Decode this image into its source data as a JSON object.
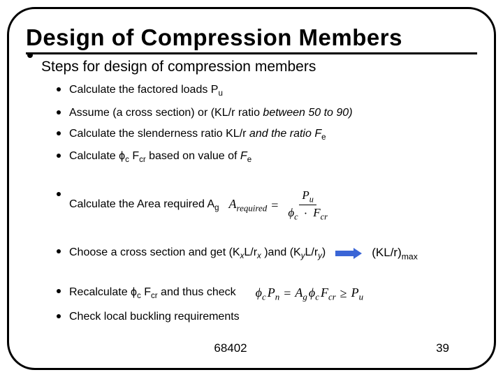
{
  "title": "Design of Compression Members",
  "heading": "Steps for design of compression members",
  "steps": [
    "Calculate the factored loads P<sub>u</sub>",
    "Assume (a cross section) or (KL/r ratio <i>between 50 to 90)</i>",
    "Calculate the slenderness ratio KL/r <i>and the ratio F</i><sub>e</sub>",
    "Calculate ϕ<sub>c</sub> F<sub>cr</sub> based on value of <i>F</i><sub>e</sub>",
    "Calculate the Area required A<sub>g</sub>",
    "Choose a cross section and get (K<span class='subi'>x</span>L/r<span class='subi'>x</span> )and (K<span class='subi'>y</span>L/r<span class='subi'>y</span>)",
    "Recalculate ϕ<sub>c</sub> F<sub>cr</sub> and thus check",
    "Check local buckling requirements"
  ],
  "eq1": {
    "lhs": "A",
    "lhs_sub": "required",
    "num": "P",
    "num_sub": "u",
    "den_phi": "ϕ",
    "den_phi_sub": "c",
    "den_f": "F",
    "den_f_sub": "cr"
  },
  "eq2": {
    "phi": "ϕ",
    "phi_sub": "c",
    "P": "P",
    "P_sub": "n",
    "A": "A",
    "A_sub": "g",
    "F": "F",
    "F_sub": "cr",
    "Pu": "P",
    "Pu_sub": "u"
  },
  "klr_max": "(KL/r)",
  "klr_max_sub": "max",
  "footer": {
    "id": "68402",
    "page": "39"
  }
}
